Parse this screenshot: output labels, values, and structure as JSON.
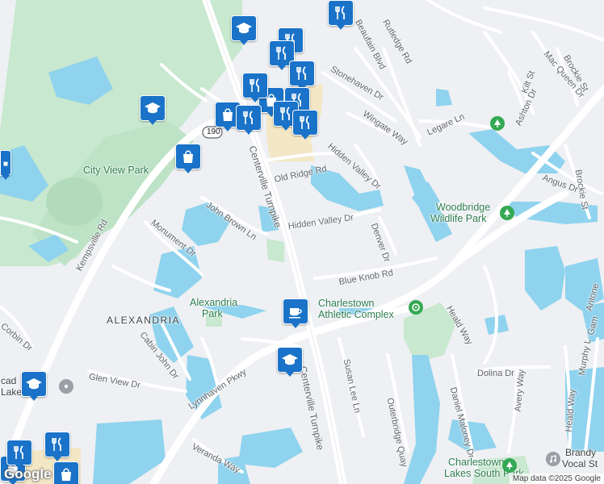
{
  "map": {
    "roads": [
      {
        "name": "Centerville Turnpike",
        "name_2": "Centerville Turnpike"
      },
      {
        "name": "Kempsville Rd"
      },
      {
        "name": "Lynnhaven Pkwy"
      },
      {
        "name": "Old Ridge Rd"
      },
      {
        "name": "Hidden Valley Dr",
        "name_2": "Hidden Valley Dr"
      },
      {
        "name": "Blue Knob Rd"
      },
      {
        "name": "John Brown Ln"
      },
      {
        "name": "Monument Dr"
      },
      {
        "name": "Corbin Dr"
      },
      {
        "name": "Cabin John Dr"
      },
      {
        "name": "Glen View Dr"
      },
      {
        "name": "Veranda Way"
      },
      {
        "name": "Susan Lee Ln"
      },
      {
        "name": "Outerbridge Quay"
      },
      {
        "name": "Daniel Maloney Dr"
      },
      {
        "name": "Avery Way"
      },
      {
        "name": "Dolina Dr"
      },
      {
        "name": "Heald Way",
        "name_2": "Heald Way"
      },
      {
        "name": "Murphy L"
      },
      {
        "name": "Denver Dr"
      },
      {
        "name": "Wingate Way"
      },
      {
        "name": "Stonehaven Dr"
      },
      {
        "name": "Rutledge Rd"
      },
      {
        "name": "Beaufain Blvd"
      },
      {
        "name": "Legare Ln"
      },
      {
        "name": "Mac Queen Dr"
      },
      {
        "name": "Brockie St",
        "name_2": "Brockie St"
      },
      {
        "name": "Kilt St"
      },
      {
        "name": "Ashton Dr"
      },
      {
        "name": "Angus Dr"
      },
      {
        "name": "Antone"
      },
      {
        "name": "Gam"
      }
    ],
    "route_shield": "190",
    "places": [
      {
        "name": "City View Park"
      },
      {
        "name": "Woodbridge",
        "name_2": "Wildlife Park"
      },
      {
        "name": "Alexandria",
        "name_2": "Park"
      },
      {
        "name": "Charlestown",
        "name_2": "Athletic Complex"
      },
      {
        "name": "Charlestowne",
        "name_2": "Lakes South Park"
      },
      {
        "name": "Brandy",
        "name_2": "Vocal St"
      },
      {
        "name": "cad",
        "name_2": "Lake"
      }
    ],
    "area_label": "ALEXANDRIA",
    "markers": [
      "school-icon",
      "restaurant-icon",
      "shopping-icon",
      "cafe-icon"
    ],
    "attribution": "Map data ©2025 Google",
    "logo": "Google",
    "colors": {
      "water": "#8fd3ee",
      "park": "#c8e8cf",
      "land": "#eef0f3",
      "road": "#ffffff",
      "marker": "#1a73c8",
      "commercial": "#f3e7c6"
    }
  }
}
